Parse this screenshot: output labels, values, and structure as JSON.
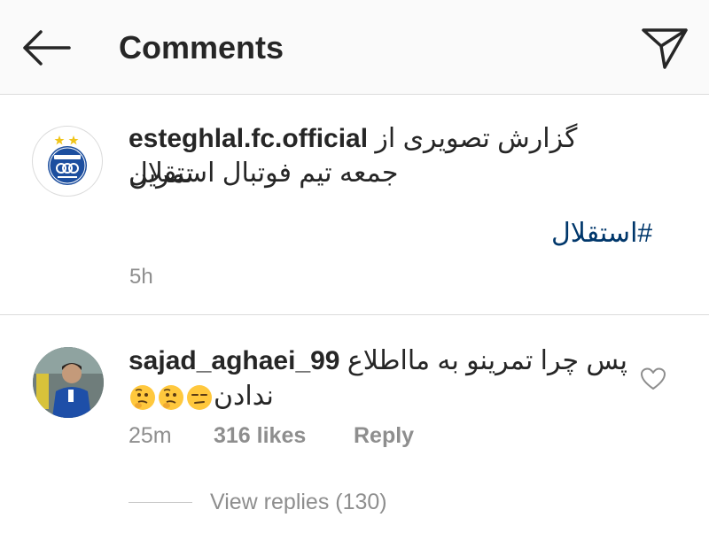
{
  "header": {
    "title": "Comments",
    "back_icon": "arrow-left-icon",
    "share_icon": "paper-plane-icon"
  },
  "caption": {
    "username": "esteghlal.fc.official",
    "text_line1": "گزارش تصویری از تمرین",
    "text_line2": "جمعه تیم فوتبال استقلال",
    "hashtag": "#استقلال",
    "time": "5h",
    "avatar_icon": "esteghlal-logo-icon"
  },
  "comment": {
    "username": "sajad_aghaei_99",
    "text_line1": "پس چرا تمرینو به مااطلاع",
    "text_line2": "ندادن",
    "emojis": [
      "thinking-face-icon",
      "thinking-face-icon",
      "unamused-face-icon"
    ],
    "time": "25m",
    "likes": "316 likes",
    "reply_label": "Reply",
    "heart_icon": "heart-outline-icon",
    "avatar_icon": "user-avatar-icon"
  },
  "replies": {
    "label": "View replies (130)"
  },
  "colors": {
    "header_bg": "#fafafa",
    "text": "#262626",
    "muted": "#8e8e8e",
    "hashtag": "#00376b",
    "brand_blue": "#1d4f9f"
  }
}
